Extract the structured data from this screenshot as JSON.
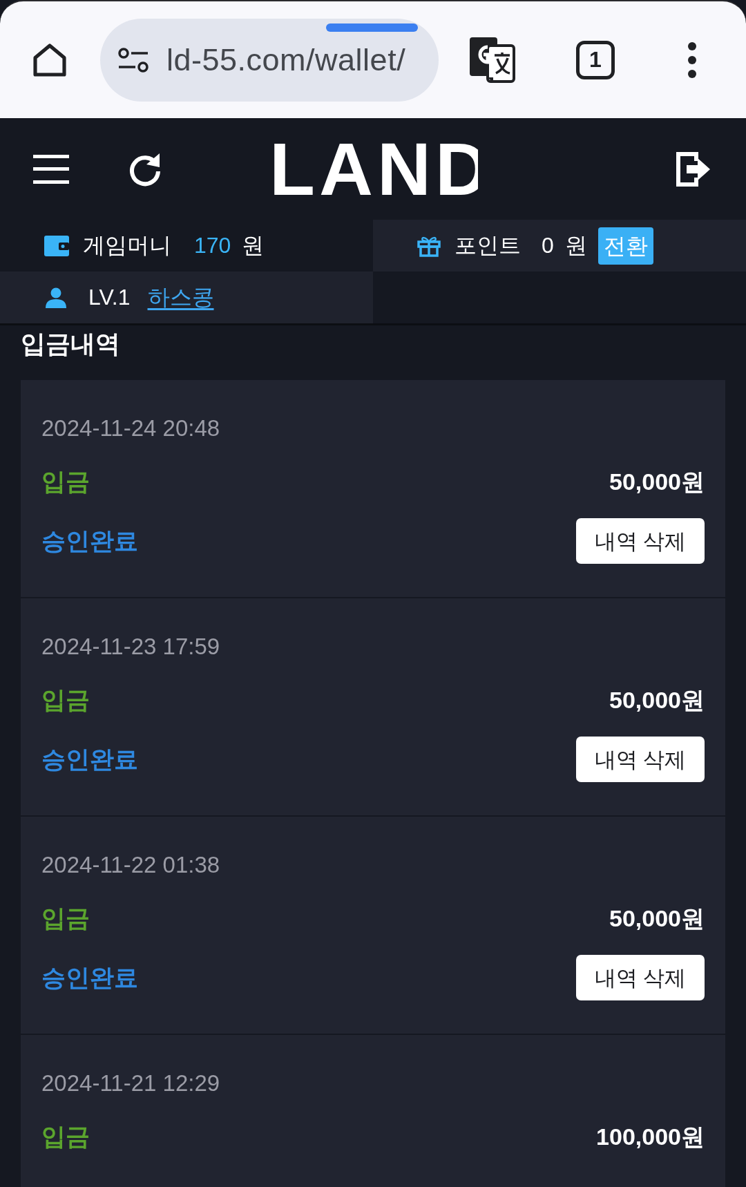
{
  "browser": {
    "url": "ld-55.com/wallet/",
    "tab_count": "1"
  },
  "header": {
    "logo": "LAND"
  },
  "balances": {
    "game_money": {
      "label": "게임머니",
      "amount": "170",
      "unit": "원"
    },
    "points": {
      "label": "포인트",
      "amount": "0",
      "unit": "원",
      "convert_button": "전환"
    }
  },
  "user": {
    "level": "LV.1",
    "nickname": "하스콩"
  },
  "section_title": "입금내역",
  "records": [
    {
      "datetime": "2024-11-24 20:48",
      "type": "입금",
      "amount": "50,000원",
      "status": "승인완료",
      "action": "내역 삭제"
    },
    {
      "datetime": "2024-11-23 17:59",
      "type": "입금",
      "amount": "50,000원",
      "status": "승인완료",
      "action": "내역 삭제"
    },
    {
      "datetime": "2024-11-22 01:38",
      "type": "입금",
      "amount": "50,000원",
      "status": "승인완료",
      "action": "내역 삭제"
    },
    {
      "datetime": "2024-11-21 12:29",
      "type": "입금",
      "amount": "100,000원"
    }
  ]
}
